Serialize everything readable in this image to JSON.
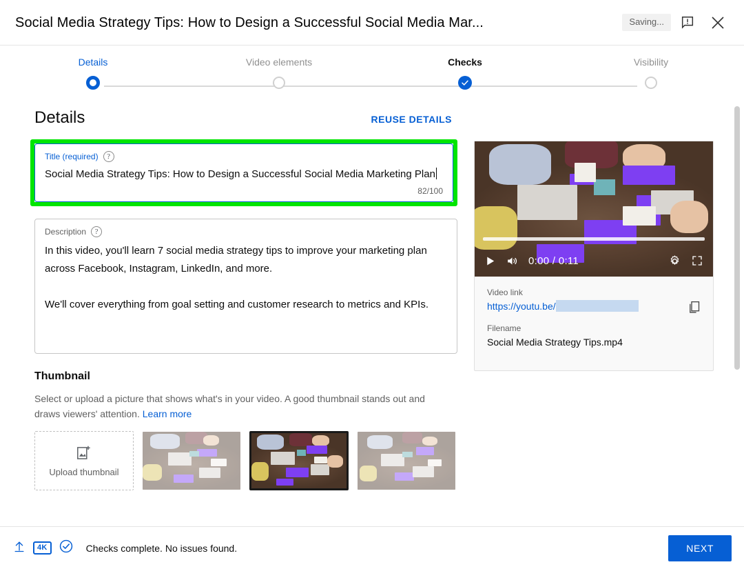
{
  "header": {
    "title": "Social Media Strategy Tips: How to Design a Successful Social Media Mar...",
    "saving_status": "Saving...",
    "feedback_icon": "feedback-icon",
    "close_icon": "close-icon"
  },
  "stepper": {
    "steps": [
      {
        "label": "Details",
        "state": "current"
      },
      {
        "label": "Video elements",
        "state": "pending"
      },
      {
        "label": "Checks",
        "state": "done"
      },
      {
        "label": "Visibility",
        "state": "pending"
      }
    ]
  },
  "details": {
    "section_title": "Details",
    "reuse_label": "REUSE DETAILS",
    "title_field": {
      "label": "Title (required)",
      "help_icon": "help-circle-icon",
      "value": "Social Media Strategy Tips: How to Design a Successful Social Media Marketing Plan",
      "char_count": "82/100"
    },
    "description_field": {
      "label": "Description",
      "help_icon": "help-circle-icon",
      "value": "In this video, you'll learn 7 social media strategy tips to improve your marketing plan across Facebook, Instagram, LinkedIn, and more.\n\nWe'll cover everything from goal setting and customer research to metrics and KPIs."
    }
  },
  "thumbnail": {
    "title": "Thumbnail",
    "description": "Select or upload a picture that shows what's in your video. A good thumbnail stands out and draws viewers' attention.",
    "learn_more": "Learn more",
    "upload_label": "Upload thumbnail",
    "upload_icon": "add-image-icon",
    "options": [
      {
        "name": "auto-thumbnail-1",
        "selected": false
      },
      {
        "name": "auto-thumbnail-2",
        "selected": true
      },
      {
        "name": "auto-thumbnail-3",
        "selected": false
      }
    ]
  },
  "video_panel": {
    "player": {
      "play_icon": "play-icon",
      "volume_icon": "volume-icon",
      "time": "0:00 / 0:11",
      "settings_icon": "gear-icon",
      "fullscreen_icon": "fullscreen-icon"
    },
    "video_link_label": "Video link",
    "video_link_value": "https://youtu.be/",
    "video_link_redacted": true,
    "copy_icon": "copy-icon",
    "filename_label": "Filename",
    "filename_value": "Social Media Strategy Tips.mp4"
  },
  "footer": {
    "upload_icon": "upload-icon",
    "quality_badge": "4K",
    "check_icon": "check-circle-icon",
    "status_text": "Checks complete. No issues found.",
    "next_label": "NEXT"
  },
  "colors": {
    "accent_blue": "#065fd4",
    "highlight_green": "#00e500",
    "muted_gray": "#606060",
    "redact_blue": "#c5d9f0"
  }
}
